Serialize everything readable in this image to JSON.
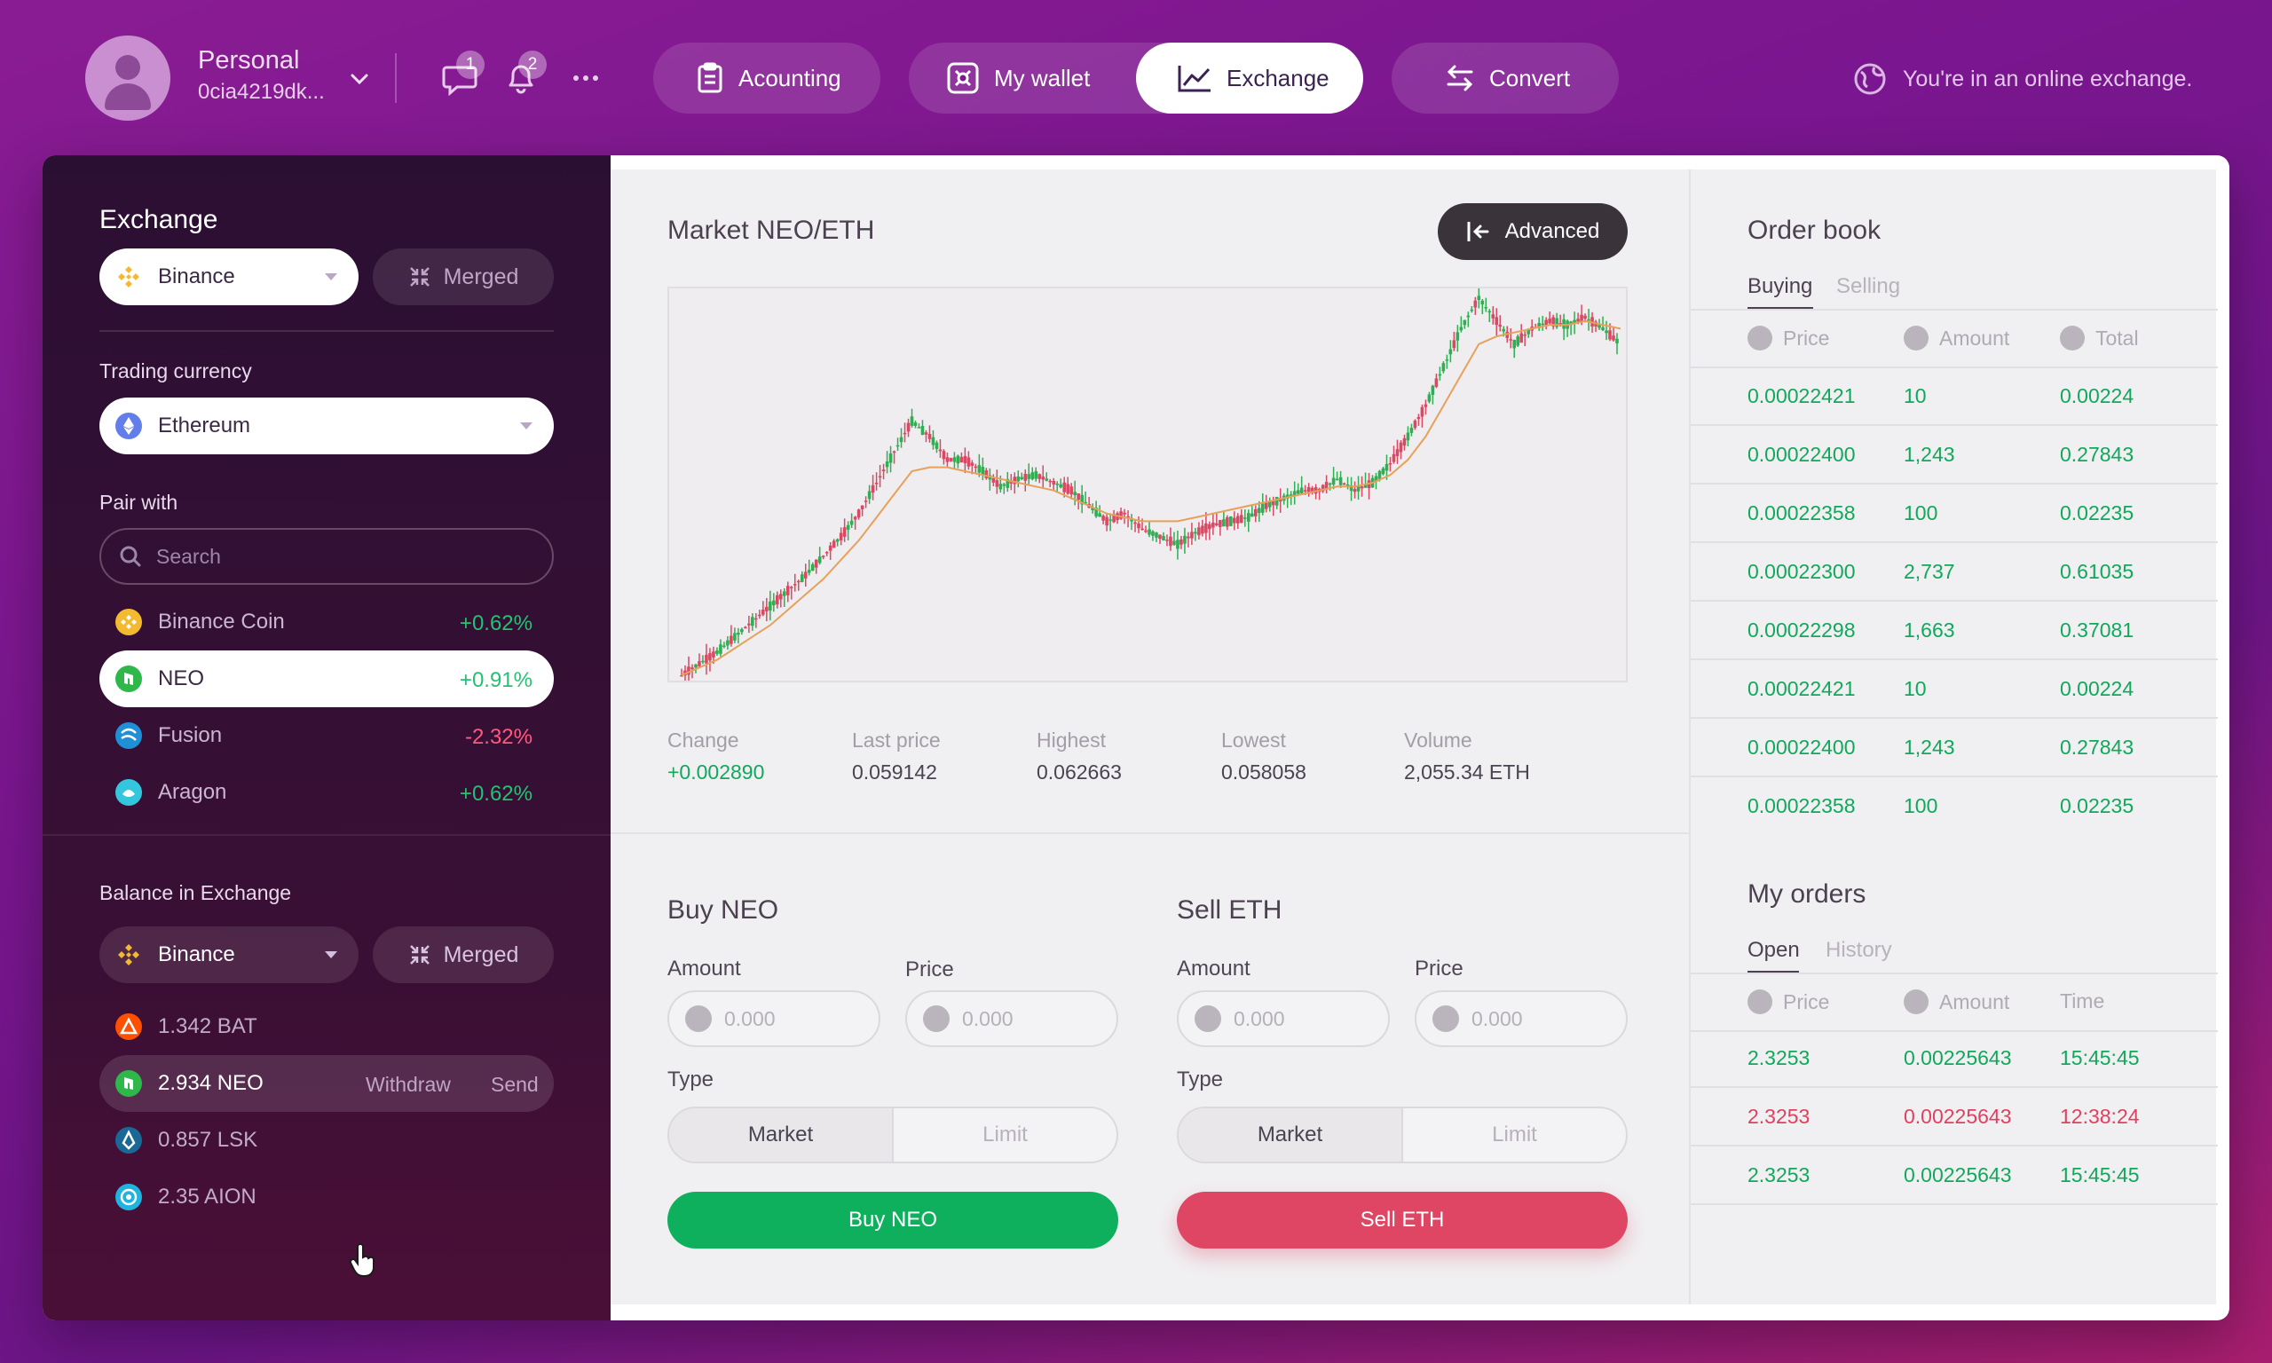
{
  "account": {
    "name": "Personal",
    "id": "0cia4219dk..."
  },
  "notifications": {
    "messages_count": "1",
    "alerts_count": "2"
  },
  "nav": {
    "accounting": "Acounting",
    "wallet": "My wallet",
    "exchange": "Exchange",
    "convert": "Convert"
  },
  "status_note": "You're in an online exchange.",
  "sidebar": {
    "exchange_title": "Exchange",
    "exchange_select": "Binance",
    "merged_label": "Merged",
    "trading_currency_label": "Trading currency",
    "trading_currency_value": "Ethereum",
    "pair_with_label": "Pair with",
    "search_placeholder": "Search",
    "pairs": [
      {
        "name": "Binance Coin",
        "change": "+0.62%"
      },
      {
        "name": "NEO",
        "change": "+0.91%"
      },
      {
        "name": "Fusion",
        "change": "-2.32%"
      },
      {
        "name": "Aragon",
        "change": "+0.62%"
      }
    ],
    "balance_title": "Balance in Exchange",
    "balance_select": "Binance",
    "balances": [
      "1.342 BAT",
      "2.934 NEO",
      "0.857 LSK",
      "2.35 AION"
    ],
    "withdraw_label": "Withdraw",
    "send_label": "Send"
  },
  "market": {
    "title": "Market NEO/ETH",
    "advanced_label": "Advanced",
    "stats": [
      {
        "label": "Change",
        "value": "+0.002890"
      },
      {
        "label": "Last price",
        "value": "0.059142"
      },
      {
        "label": "Highest",
        "value": "0.062663"
      },
      {
        "label": "Lowest",
        "value": "0.058058"
      },
      {
        "label": "Volume",
        "value": "2,055.34 ETH"
      }
    ]
  },
  "chart_data": {
    "type": "candlestick",
    "title": "",
    "series": [
      {
        "values": [
          0.0,
          0.03,
          0.06,
          0.1,
          0.14,
          0.18,
          0.22,
          0.26,
          0.31,
          0.36,
          0.42,
          0.5,
          0.58,
          0.66,
          0.62,
          0.56,
          0.56,
          0.53,
          0.49,
          0.51,
          0.52,
          0.5,
          0.48,
          0.44,
          0.4,
          0.42,
          0.38,
          0.36,
          0.34,
          0.37,
          0.39,
          0.4,
          0.41,
          0.44,
          0.46,
          0.48,
          0.48,
          0.51,
          0.48,
          0.5,
          0.55,
          0.62,
          0.7,
          0.8,
          0.9,
          0.98,
          0.92,
          0.86,
          0.9,
          0.92,
          0.91,
          0.93,
          0.9,
          0.86
        ]
      },
      {
        "values": [
          0.0,
          0.02,
          0.04,
          0.07,
          0.1,
          0.13,
          0.17,
          0.21,
          0.25,
          0.3,
          0.35,
          0.41,
          0.47,
          0.53,
          0.54,
          0.54,
          0.53,
          0.52,
          0.51,
          0.5,
          0.49,
          0.48,
          0.46,
          0.44,
          0.42,
          0.41,
          0.4,
          0.4,
          0.4,
          0.41,
          0.42,
          0.43,
          0.44,
          0.45,
          0.46,
          0.47,
          0.48,
          0.49,
          0.49,
          0.5,
          0.52,
          0.56,
          0.62,
          0.7,
          0.78,
          0.86,
          0.88,
          0.89,
          0.9,
          0.91,
          0.91,
          0.92,
          0.91,
          0.9
        ]
      }
    ]
  },
  "buy": {
    "title": "Buy NEO",
    "amount_label": "Amount",
    "price_label": "Price",
    "placeholder": "0.000",
    "type_label": "Type",
    "market": "Market",
    "limit": "Limit",
    "button": "Buy NEO"
  },
  "sell": {
    "title": "Sell ETH",
    "amount_label": "Amount",
    "price_label": "Price",
    "placeholder": "0.000",
    "type_label": "Type",
    "market": "Market",
    "limit": "Limit",
    "button": "Sell ETH"
  },
  "order_book": {
    "title": "Order book",
    "tab_buying": "Buying",
    "tab_selling": "Selling",
    "col_price": "Price",
    "col_amount": "Amount",
    "col_total": "Total",
    "rows": [
      [
        "0.00022421",
        "10",
        "0.00224"
      ],
      [
        "0.00022400",
        "1,243",
        "0.27843"
      ],
      [
        "0.00022358",
        "100",
        "0.02235"
      ],
      [
        "0.00022300",
        "2,737",
        "0.61035"
      ],
      [
        "0.00022298",
        "1,663",
        "0.37081"
      ],
      [
        "0.00022421",
        "10",
        "0.00224"
      ],
      [
        "0.00022400",
        "1,243",
        "0.27843"
      ],
      [
        "0.00022358",
        "100",
        "0.02235"
      ]
    ]
  },
  "my_orders": {
    "title": "My orders",
    "tab_open": "Open",
    "tab_history": "History",
    "col_price": "Price",
    "col_amount": "Amount",
    "col_time": "Time",
    "rows": [
      [
        "2.3253",
        "0.00225643",
        "15:45:45"
      ],
      [
        "2.3253",
        "0.00225643",
        "12:38:24"
      ],
      [
        "2.3253",
        "0.00225643",
        "15:45:45"
      ]
    ]
  },
  "colors": {
    "buy": "#0fb05d",
    "sell": "#df4663",
    "positive": "#25c173",
    "negative": "#ff5a7e"
  }
}
